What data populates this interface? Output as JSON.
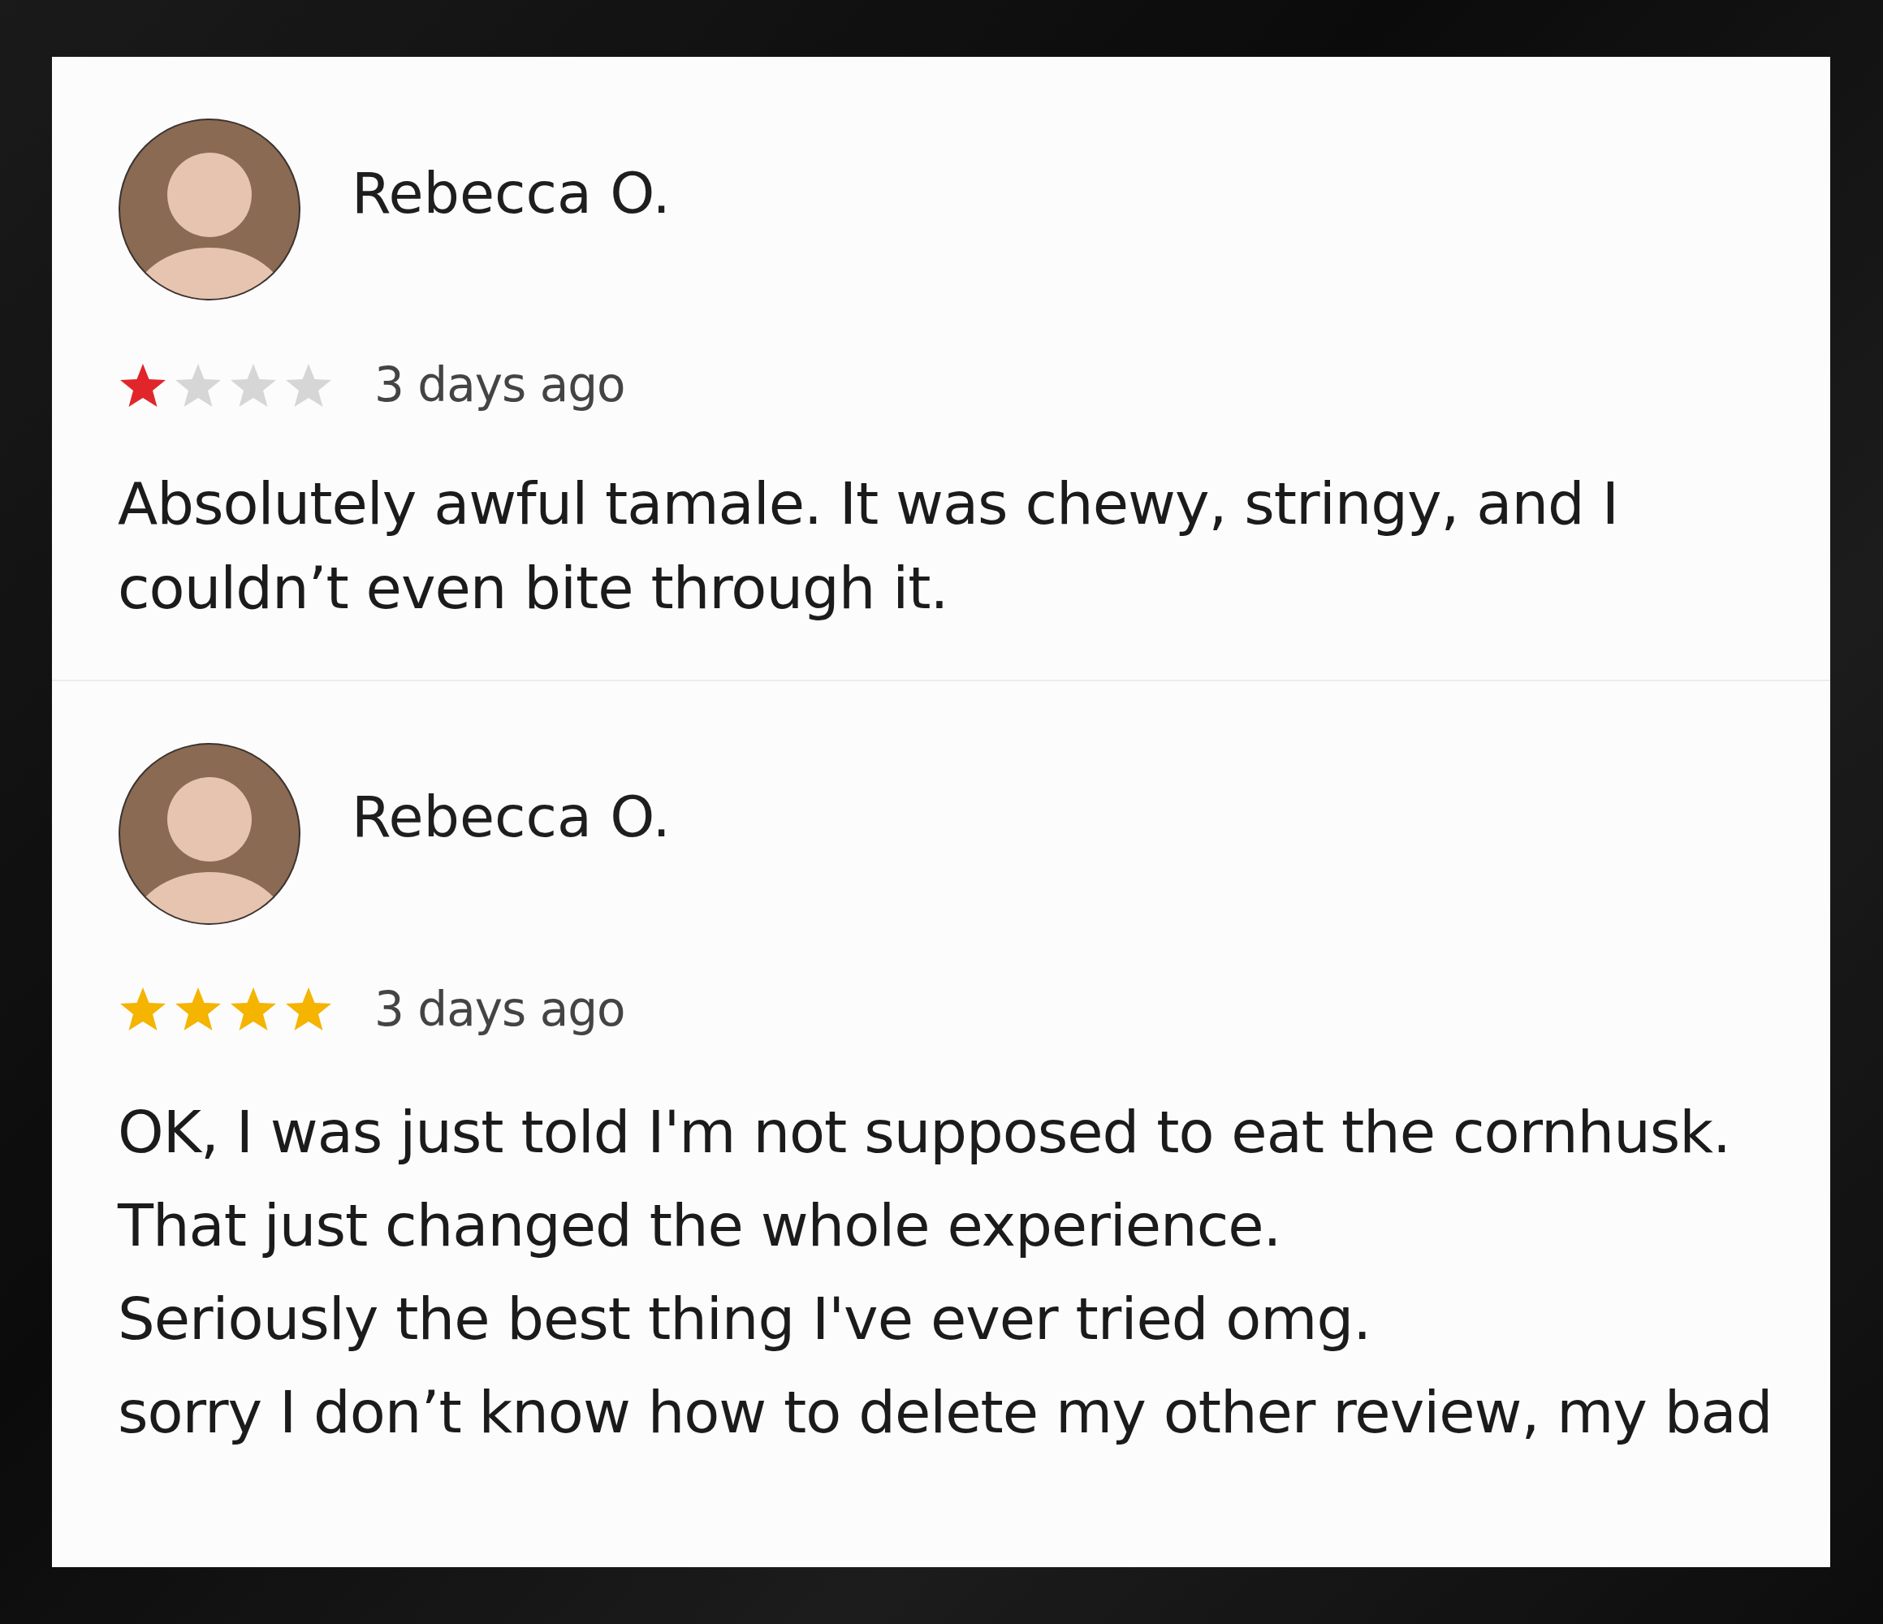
{
  "reviews": [
    {
      "author": "Rebecca O.",
      "stars": 1,
      "color": "#e0262b",
      "time": "3 days ago",
      "paragraphs": [
        "Absolutely awful tamale. It was chewy, stringy, and I couldn’t even bite through it."
      ]
    },
    {
      "author": "Rebecca O.",
      "stars": 4,
      "color": "#f4b400",
      "time": "3 days ago",
      "paragraphs": [
        "OK, I was just told I'm not supposed to eat the cornhusk.",
        "That just changed the whole experience.",
        "Seriously the best thing I've ever tried omg.",
        "sorry I don’t know how to delete my other review, my bad"
      ]
    }
  ]
}
